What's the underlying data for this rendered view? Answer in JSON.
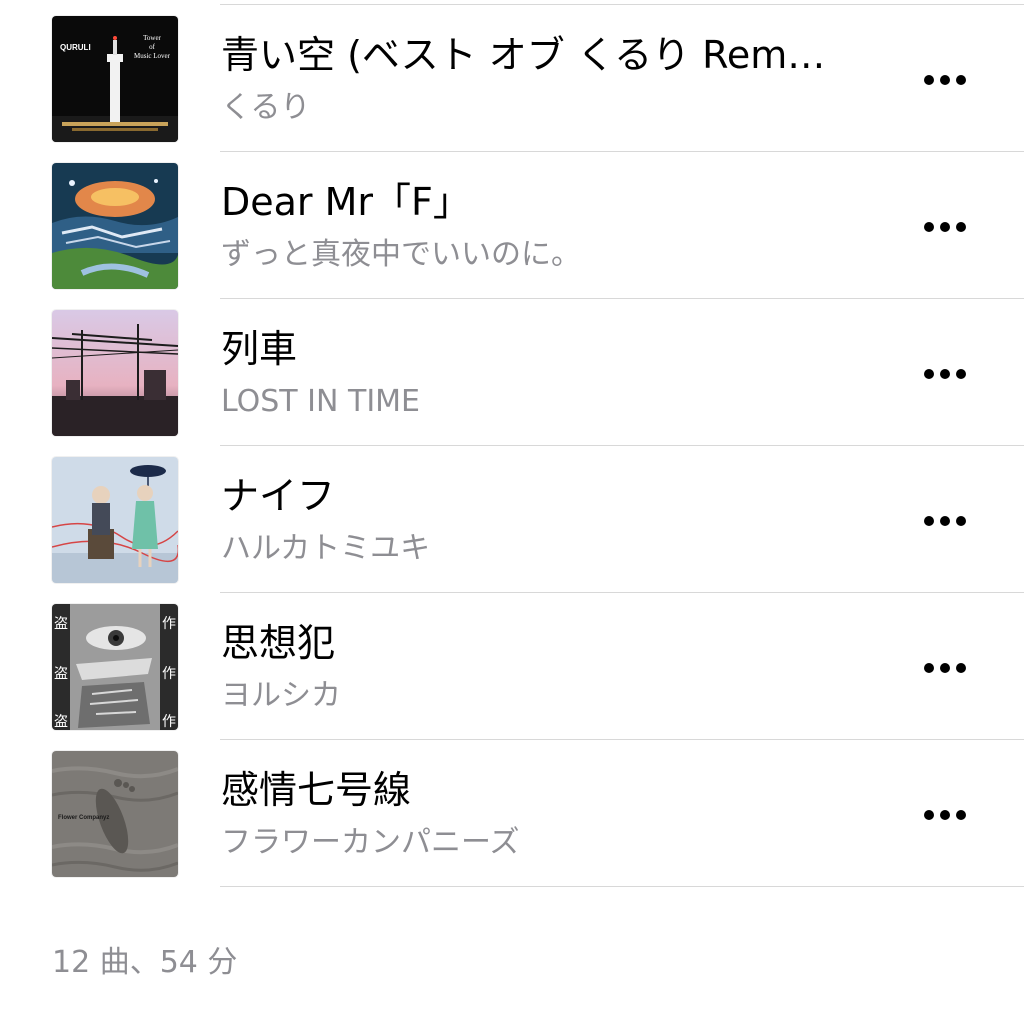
{
  "tracks": [
    {
      "title": "青い空 (ベスト オブ くるり Rem…",
      "artist": "くるり",
      "artwork": {
        "kind": "night-tower",
        "band_text": "QURULI",
        "album_line1": "Tower",
        "album_line2": "of",
        "album_line3": "Music Lover"
      }
    },
    {
      "title": "Dear Mr「F」",
      "artist": "ずっと真夜中でいいのに。",
      "artwork": {
        "kind": "painted-landscape"
      }
    },
    {
      "title": "列車",
      "artist": "LOST IN TIME",
      "artwork": {
        "kind": "train-wires"
      }
    },
    {
      "title": "ナイフ",
      "artist": "ハルカトミユキ",
      "artwork": {
        "kind": "two-figures"
      }
    },
    {
      "title": "思想犯",
      "artist": "ヨルシカ",
      "artwork": {
        "kind": "collage-face",
        "side_glyph_left": "盗",
        "side_glyph_right": "作"
      }
    },
    {
      "title": "感情七号線",
      "artist": "フラワーカンパニーズ",
      "artwork": {
        "kind": "sand-footprint",
        "band_text": "Flower Companyz"
      }
    }
  ],
  "more_icon": "ellipsis-icon",
  "summary": "12 曲、54 分",
  "colors": {
    "title": "#000000",
    "subtitle": "#8e8e93",
    "divider": "#d8d8d8",
    "background": "#ffffff"
  }
}
